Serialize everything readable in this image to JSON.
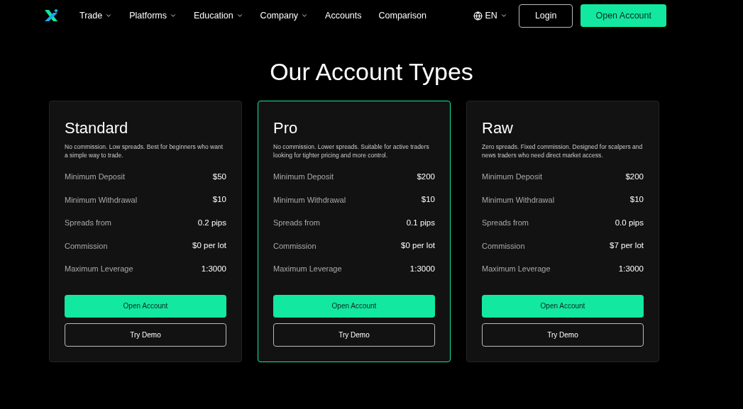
{
  "nav": {
    "items": [
      {
        "label": "Trade",
        "has_menu": true
      },
      {
        "label": "Platforms",
        "has_menu": true
      },
      {
        "label": "Education",
        "has_menu": true
      },
      {
        "label": "Company",
        "has_menu": true
      },
      {
        "label": "Accounts",
        "has_menu": false
      },
      {
        "label": "Comparison",
        "has_menu": false
      }
    ],
    "language": "EN",
    "login": "Login",
    "open_account": "Open Account"
  },
  "heading": "Our Account Types",
  "accounts": [
    {
      "name": "Standard",
      "highlighted": false,
      "description": "No commission. Low spreads. Best for beginners who want a simple way to trade.",
      "rows": [
        {
          "label": "Minimum Deposit",
          "value": "$50"
        },
        {
          "label": "Minimum Withdrawal",
          "value": "$10"
        },
        {
          "label": "Spreads from",
          "value": "0.2 pips"
        },
        {
          "label": "Commission",
          "value": "$0 per lot"
        },
        {
          "label": "Maximum Leverage",
          "value": "1:3000"
        }
      ],
      "primary": "Open Account",
      "secondary": "Try Demo"
    },
    {
      "name": "Pro",
      "highlighted": true,
      "description": "No commission. Lower spreads. Suitable for active traders looking for tighter pricing and more control.",
      "rows": [
        {
          "label": "Minimum Deposit",
          "value": "$200"
        },
        {
          "label": "Minimum Withdrawal",
          "value": "$10"
        },
        {
          "label": "Spreads from",
          "value": "0.1 pips"
        },
        {
          "label": "Commission",
          "value": "$0 per lot"
        },
        {
          "label": "Maximum Leverage",
          "value": "1:3000"
        }
      ],
      "primary": "Open Account",
      "secondary": "Try Demo"
    },
    {
      "name": "Raw",
      "highlighted": false,
      "description": "Zero spreads. Fixed commission. Designed for scalpers and news traders who need direct market access.",
      "rows": [
        {
          "label": "Minimum Deposit",
          "value": "$200"
        },
        {
          "label": "Minimum Withdrawal",
          "value": "$10"
        },
        {
          "label": "Spreads from",
          "value": "0.0 pips"
        },
        {
          "label": "Commission",
          "value": "$7 per lot"
        },
        {
          "label": "Maximum Leverage",
          "value": "1:3000"
        }
      ],
      "primary": "Open Account",
      "secondary": "Try Demo"
    }
  ]
}
